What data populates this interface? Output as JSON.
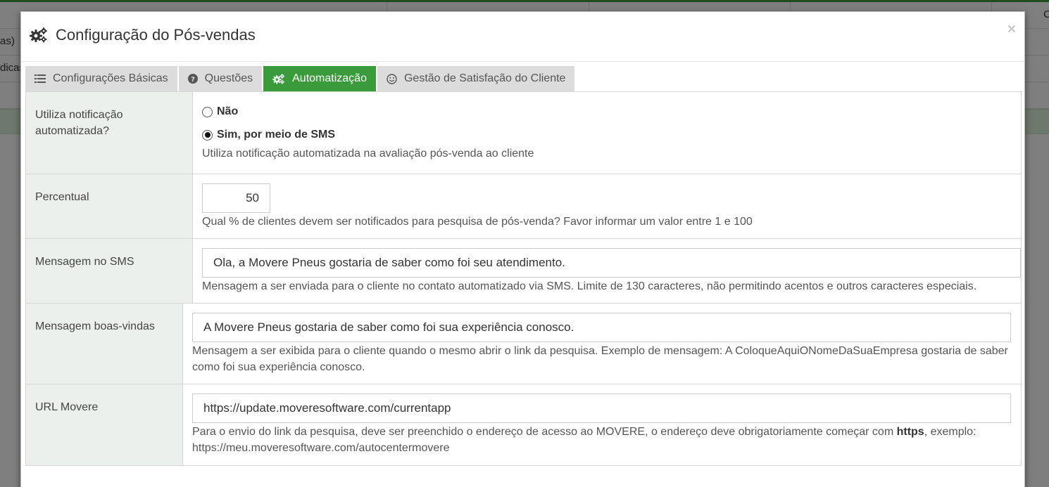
{
  "background": {
    "row1_text": "as)",
    "row2_text": "dicas",
    "right_letter": "C"
  },
  "modal": {
    "title": "Configuração do Pós-vendas",
    "close_label": "×"
  },
  "tabs": [
    {
      "label": "Configurações Básicas",
      "icon": "list-icon"
    },
    {
      "label": "Questões",
      "icon": "question-circle-icon"
    },
    {
      "label": "Automatização",
      "icon": "gears-icon",
      "active": true
    },
    {
      "label": "Gestão de Satisfação do Cliente",
      "icon": "smile-icon"
    }
  ],
  "form": {
    "notification": {
      "label": "Utiliza notificação automatizada?",
      "option_no": "Não",
      "option_sms": "Sim, por meio de SMS",
      "selected": "Sim, por meio de SMS",
      "help": "Utiliza notificação automatizada na avaliação pós-venda ao cliente"
    },
    "percentual": {
      "label": "Percentual",
      "value": "50",
      "help": "Qual % de clientes devem ser notificados para pesquisa de pós-venda? Favor informar um valor entre 1 e 100"
    },
    "sms_message": {
      "label": "Mensagem no SMS",
      "value": "Ola, a Movere Pneus gostaria de saber como foi seu atendimento.",
      "help": "Mensagem a ser enviada para o cliente no contato automatizado via SMS. Limite de 130 caracteres, não permitindo acentos e outros caracteres especiais."
    },
    "welcome_message": {
      "label": "Mensagem boas-vindas",
      "value": "A Movere Pneus gostaria de saber como foi sua experiência conosco.",
      "help": "Mensagem a ser exibida para o cliente quando o mesmo abrir o link da pesquisa. Exemplo de mensagem: A ColoqueAquiONomeDaSuaEmpresa gostaria de saber como foi sua experiência conosco."
    },
    "url": {
      "label": "URL Movere",
      "value": "https://update.moveresoftware.com/currentapp",
      "help_before": "Para o envio do link da pesquisa, deve ser preenchido o endereço de acesso ao MOVERE, o endereço deve obrigatoriamente começar com ",
      "help_bold": "https",
      "help_after": ", exemplo: https://meu.moveresoftware.com/autocentermovere"
    }
  },
  "colors": {
    "accent": "#3a9b3a",
    "tab_inactive": "#dcdcdc",
    "label_bg": "#ecf0ec"
  }
}
